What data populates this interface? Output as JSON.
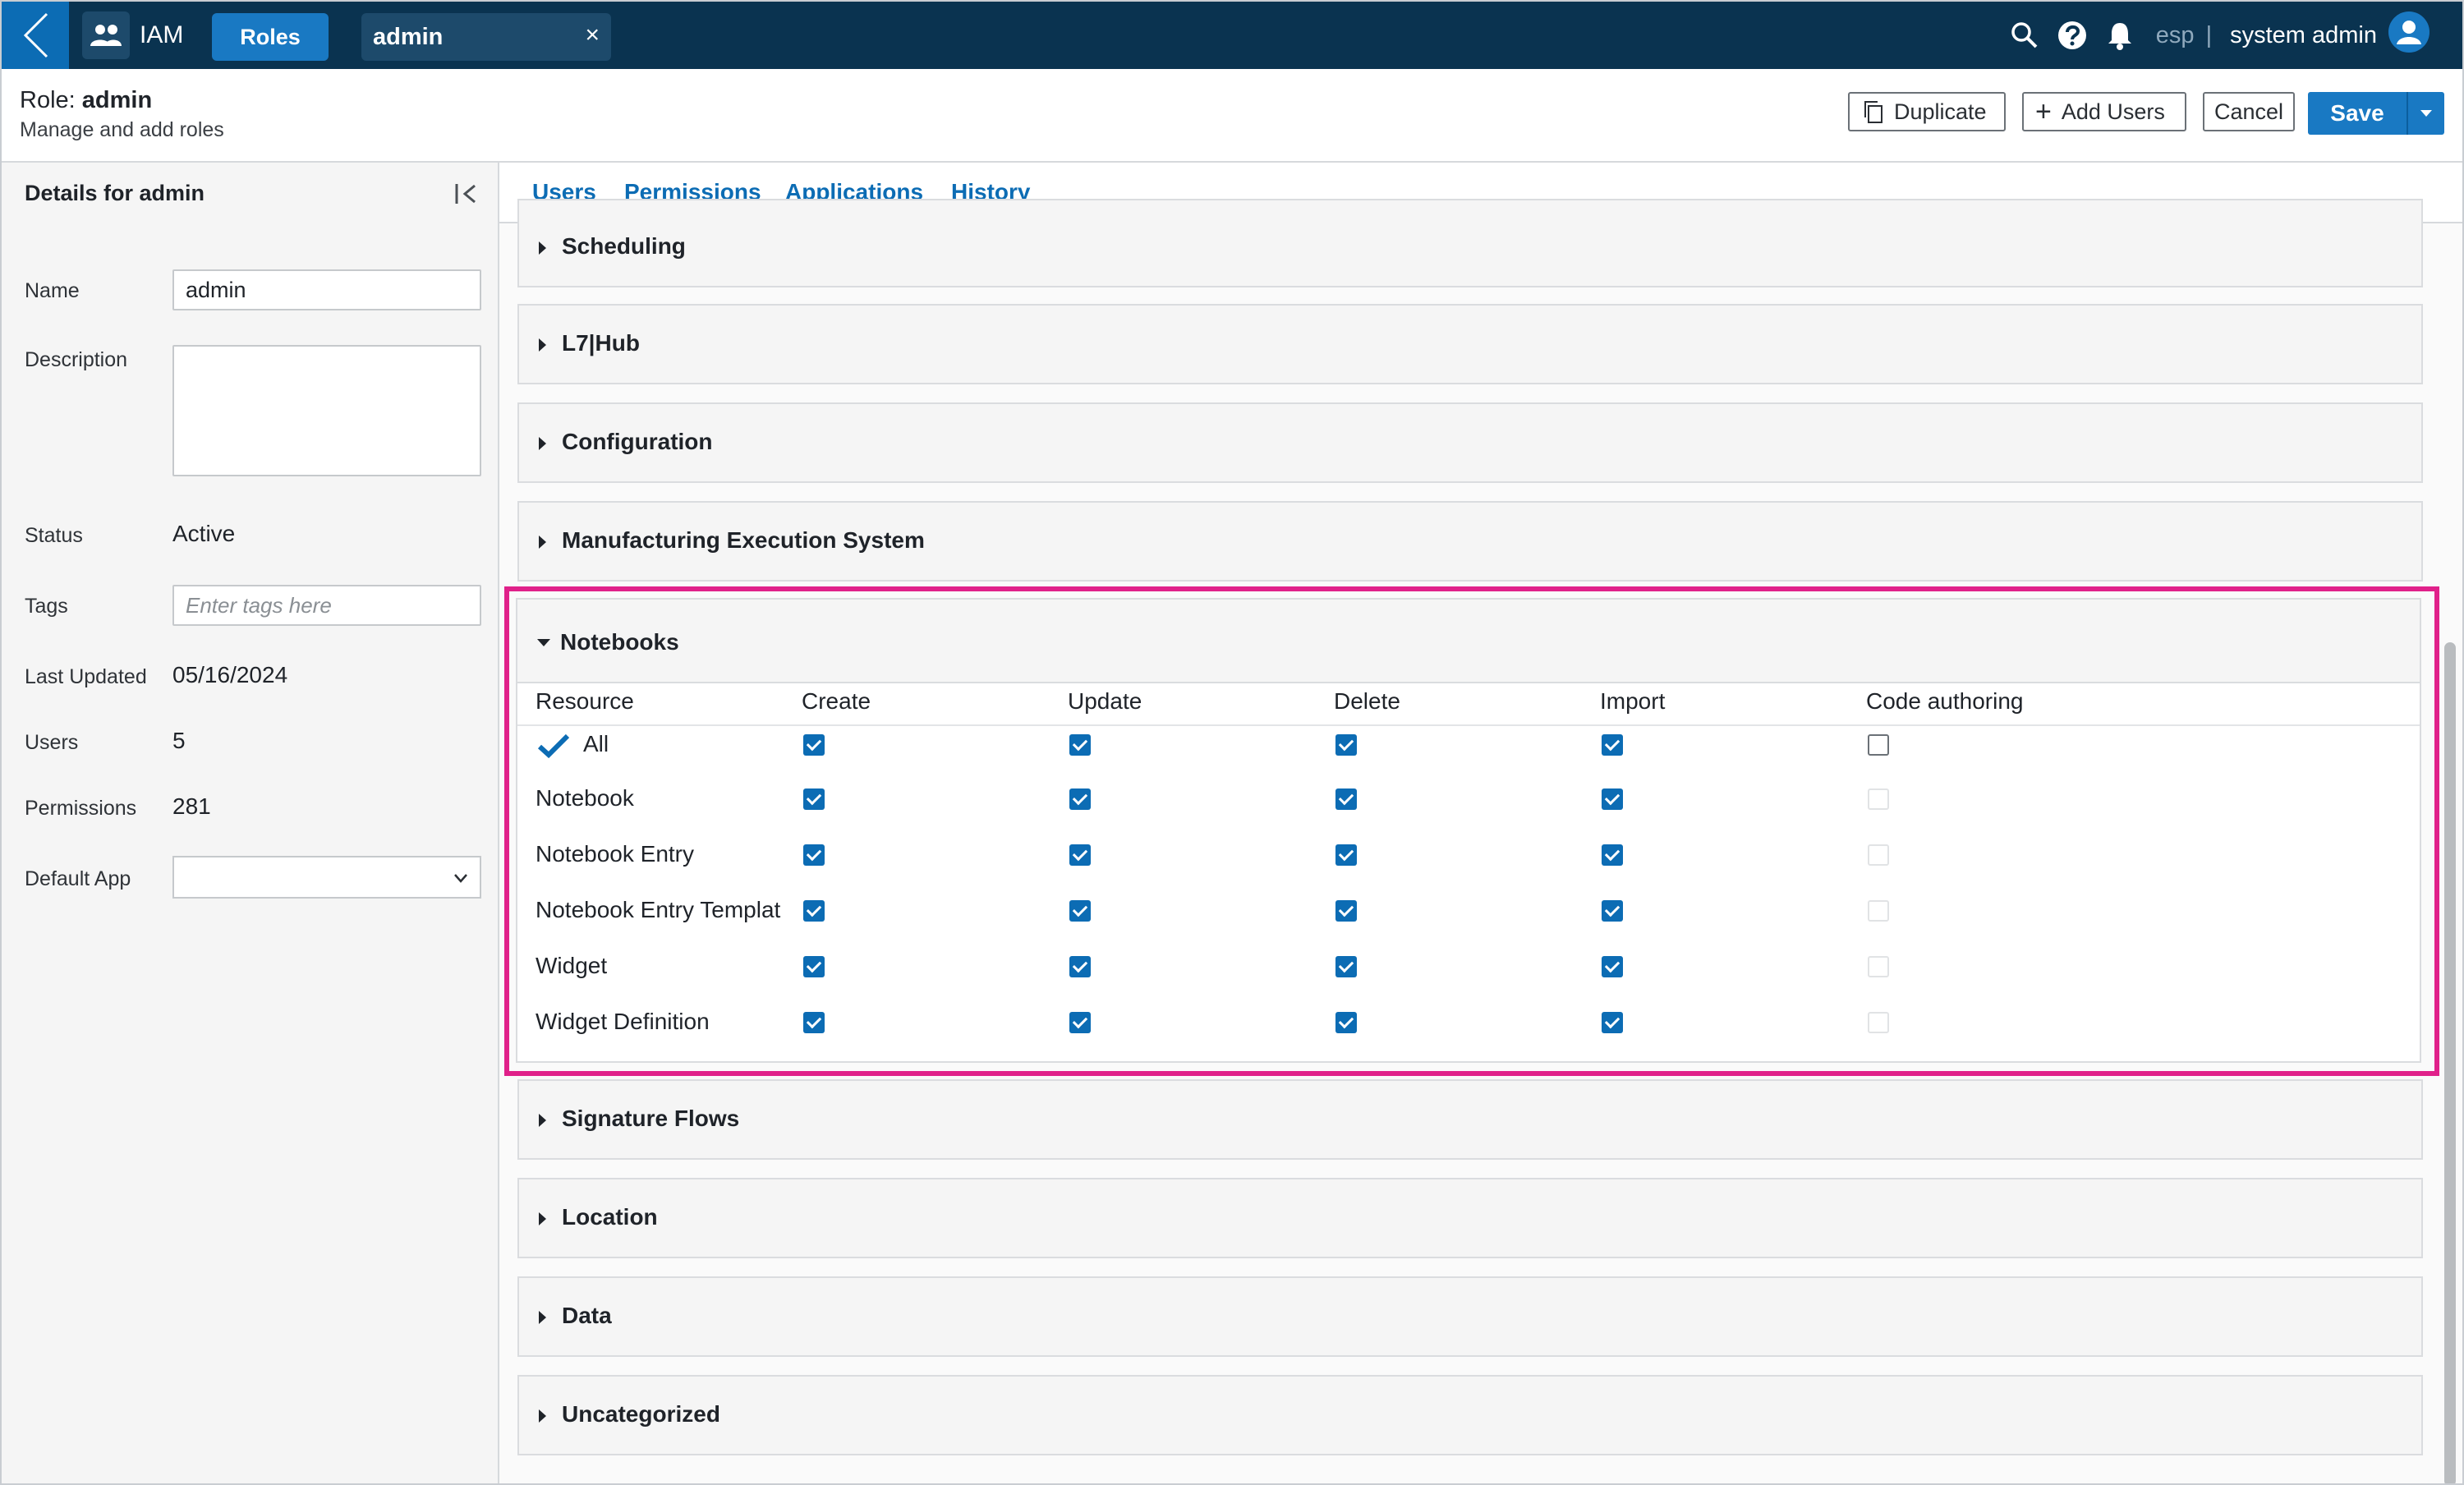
{
  "topbar": {
    "app_name": "IAM",
    "roles_label": "Roles",
    "open_tab": "admin",
    "close_glyph": "×",
    "env": "esp",
    "separator": "|",
    "user": "system admin"
  },
  "header": {
    "role_prefix": "Role:",
    "role_name": "admin",
    "subtitle": "Manage and add roles",
    "duplicate": "Duplicate",
    "add_users": "Add Users",
    "cancel": "Cancel",
    "save": "Save"
  },
  "details": {
    "title": "Details for admin",
    "name_label": "Name",
    "name_value": "admin",
    "description_label": "Description",
    "status_label": "Status",
    "status_value": "Active",
    "tags_label": "Tags",
    "tags_placeholder": "Enter tags here",
    "last_updated_label": "Last Updated",
    "last_updated_value": "05/16/2024",
    "users_label": "Users",
    "users_value": "5",
    "permissions_label": "Permissions",
    "permissions_value": "281",
    "default_app_label": "Default App"
  },
  "tabs": [
    "Users",
    "Permissions",
    "Applications",
    "History"
  ],
  "active_tab": "Permissions",
  "sections_above": [
    "Scheduling",
    "L7|Hub",
    "Configuration",
    "Manufacturing Execution System"
  ],
  "sections_below": [
    "Signature Flows",
    "Location",
    "Data",
    "Uncategorized"
  ],
  "notebooks": {
    "title": "Notebooks",
    "columns": [
      "Resource",
      "Create",
      "Update",
      "Delete",
      "Import",
      "Code authoring"
    ],
    "rows": [
      {
        "label": "All",
        "values": [
          true,
          true,
          true,
          true,
          false
        ],
        "code_enabled": true
      },
      {
        "label": "Notebook",
        "values": [
          true,
          true,
          true,
          true,
          false
        ],
        "code_enabled": false
      },
      {
        "label": "Notebook Entry",
        "values": [
          true,
          true,
          true,
          true,
          false
        ],
        "code_enabled": false
      },
      {
        "label": "Notebook Entry Templat",
        "values": [
          true,
          true,
          true,
          true,
          false
        ],
        "code_enabled": false
      },
      {
        "label": "Widget",
        "values": [
          true,
          true,
          true,
          true,
          false
        ],
        "code_enabled": false
      },
      {
        "label": "Widget Definition",
        "values": [
          true,
          true,
          true,
          true,
          false
        ],
        "code_enabled": false
      }
    ]
  },
  "colors": {
    "topbar": "#0a3350",
    "accent": "#0c6cb4",
    "highlight": "#e0218a"
  }
}
